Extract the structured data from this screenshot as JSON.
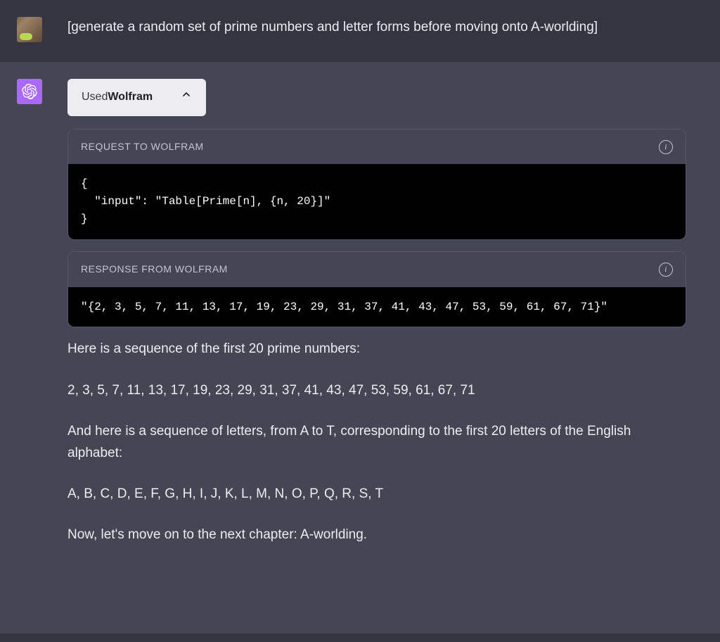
{
  "user": {
    "message": "[generate a random set of prime numbers and letter forms before moving onto A-worlding]"
  },
  "assistant": {
    "plugin_chip": {
      "prefix": "Used ",
      "name": "Wolfram"
    },
    "request_block": {
      "title": "REQUEST TO WOLFRAM",
      "code": "{\n  \"input\": \"Table[Prime[n], {n, 20}]\"\n}"
    },
    "response_block": {
      "title": "RESPONSE FROM WOLFRAM",
      "code": "\"{2, 3, 5, 7, 11, 13, 17, 19, 23, 29, 31, 37, 41, 43, 47, 53, 59, 61, 67, 71}\""
    },
    "body": {
      "p1": "Here is a sequence of the first 20 prime numbers:",
      "p2": "2, 3, 5, 7, 11, 13, 17, 19, 23, 29, 31, 37, 41, 43, 47, 53, 59, 61, 67, 71",
      "p3": "And here is a sequence of letters, from A to T, corresponding to the first 20 letters of the English alphabet:",
      "p4": "A, B, C, D, E, F, G, H, I, J, K, L, M, N, O, P, Q, R, S, T",
      "p5": "Now, let's move on to the next chapter: A-worlding."
    }
  }
}
